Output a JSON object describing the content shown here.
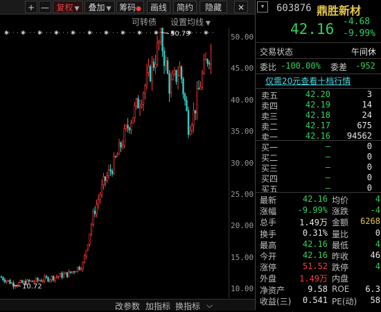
{
  "toolbar": {
    "plus": "+",
    "minus": "—",
    "adjust": "复权",
    "overlay": "叠加",
    "chips": "筹码",
    "drawing": "画线",
    "simple": "简约",
    "hide": "隐藏",
    "close": "✕"
  },
  "subbar": {
    "convertible": "可转债",
    "set_ma": "设置均线"
  },
  "chart_data": {
    "type": "candlestick",
    "y_ticks": [
      "50.00",
      "45.00",
      "40.00",
      "35.00",
      "30.00",
      "25.00",
      "20.00",
      "15.00",
      "10.00"
    ],
    "ylim": [
      8.5,
      51.5
    ],
    "high_marker": "50.79",
    "low_marker": "10.72",
    "series_desc": "daily candles rising from ~10 to ~50",
    "colors": {
      "up": "#ff3b3b",
      "down": "#2fd3c8"
    }
  },
  "bottom_bar": {
    "change_params": "改参数",
    "add_indicator": "加指标",
    "change_indicator": "换指标",
    "arrow": "⌵"
  },
  "stock": {
    "code": "603876",
    "name": "鼎胜新材",
    "price": "42.16",
    "change": "-4.68",
    "change_pct": "-9.99%",
    "status_label": "交易状态",
    "status_value": "午间休",
    "commission_ratio_label": "委比",
    "commission_ratio": "-100.00%",
    "commission_diff_label": "委差",
    "commission_diff": "-952",
    "promo": "仅需20元查看十档行情"
  },
  "sell": [
    {
      "label": "卖五",
      "price": "42.20",
      "vol": "3"
    },
    {
      "label": "卖四",
      "price": "42.19",
      "vol": "14"
    },
    {
      "label": "卖三",
      "price": "42.18",
      "vol": "24"
    },
    {
      "label": "卖二",
      "price": "42.17",
      "vol": "675"
    },
    {
      "label": "卖一",
      "price": "42.16",
      "vol": "94562"
    }
  ],
  "buy": [
    {
      "label": "买一",
      "price": "—",
      "vol": "0"
    },
    {
      "label": "买二",
      "price": "—",
      "vol": "0"
    },
    {
      "label": "买三",
      "price": "—",
      "vol": "0"
    },
    {
      "label": "买四",
      "price": "—",
      "vol": "0"
    },
    {
      "label": "买五",
      "price": "—",
      "vol": "0"
    }
  ],
  "stats": [
    {
      "l1": "最新",
      "v1": "42.16",
      "c1": "green",
      "l2": "均价",
      "v2": "4",
      "c2": "green"
    },
    {
      "l1": "涨幅",
      "v1": "-9.99%",
      "c1": "green",
      "l2": "涨跌",
      "v2": "-4",
      "c2": "green"
    },
    {
      "l1": "总手",
      "v1": "1.49万",
      "c1": "white",
      "l2": "金额",
      "v2": "6268",
      "c2": "yellow"
    },
    {
      "l1": "换手",
      "v1": "0.31%",
      "c1": "white",
      "l2": "量比",
      "v2": "0",
      "c2": "white"
    },
    {
      "l1": "最高",
      "v1": "42.16",
      "c1": "green",
      "l2": "最低",
      "v2": "4",
      "c2": "green"
    },
    {
      "l1": "今开",
      "v1": "42.16",
      "c1": "green",
      "l2": "昨收",
      "v2": "46",
      "c2": "white"
    },
    {
      "l1": "涨停",
      "v1": "51.52",
      "c1": "red",
      "l2": "跌停",
      "v2": "4",
      "c2": "green"
    },
    {
      "l1": "外盘",
      "v1": "1.49万",
      "c1": "red",
      "l2": "内盘",
      "v2": "",
      "c2": "green"
    },
    {
      "l1": "净资产",
      "v1": "9.58",
      "c1": "white",
      "l2": "ROE",
      "v2": "6.3",
      "c2": "white"
    },
    {
      "l1": "收益(三)",
      "v1": "0.541",
      "c1": "white",
      "l2": "PE(动)",
      "v2": "58",
      "c2": "white"
    }
  ]
}
